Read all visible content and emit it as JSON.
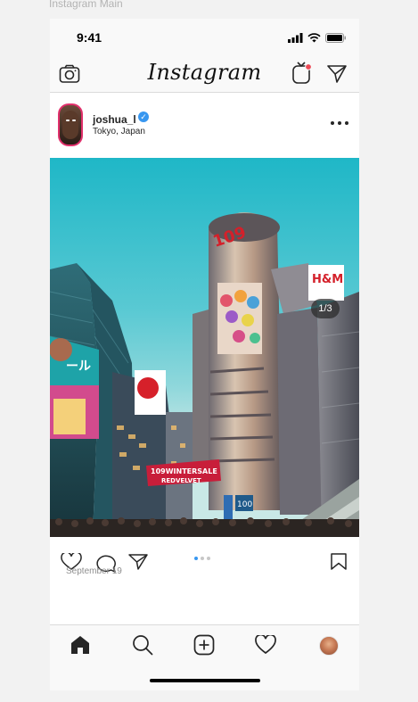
{
  "frame_label": "Instagram Main",
  "status_bar": {
    "time": "9:41"
  },
  "header": {
    "logo": "Instagram",
    "icons": [
      "camera-icon",
      "igtv-icon",
      "direct-message-icon"
    ],
    "notification_dot_color": "#ed4956"
  },
  "post": {
    "username": "joshua_l",
    "verified": true,
    "location": "Tokyo, Japan",
    "image_counter": "1/3",
    "date": "September 19",
    "carousel_total": 3,
    "carousel_active": 1,
    "photo_texts": {
      "sign_109": "109",
      "sign_hm": "H&M",
      "banner_line1": "109WINTERSALE",
      "banner_line2": "REDVELVET",
      "billboard_1": "ール",
      "sign_100": "100"
    }
  },
  "tab_bar": {
    "items": [
      "home-icon",
      "search-icon",
      "add-post-icon",
      "activity-heart-icon",
      "profile-avatar"
    ]
  },
  "colors": {
    "accent_blue": "#3897f0",
    "sky": "#1fb7c7",
    "text": "#262626"
  }
}
